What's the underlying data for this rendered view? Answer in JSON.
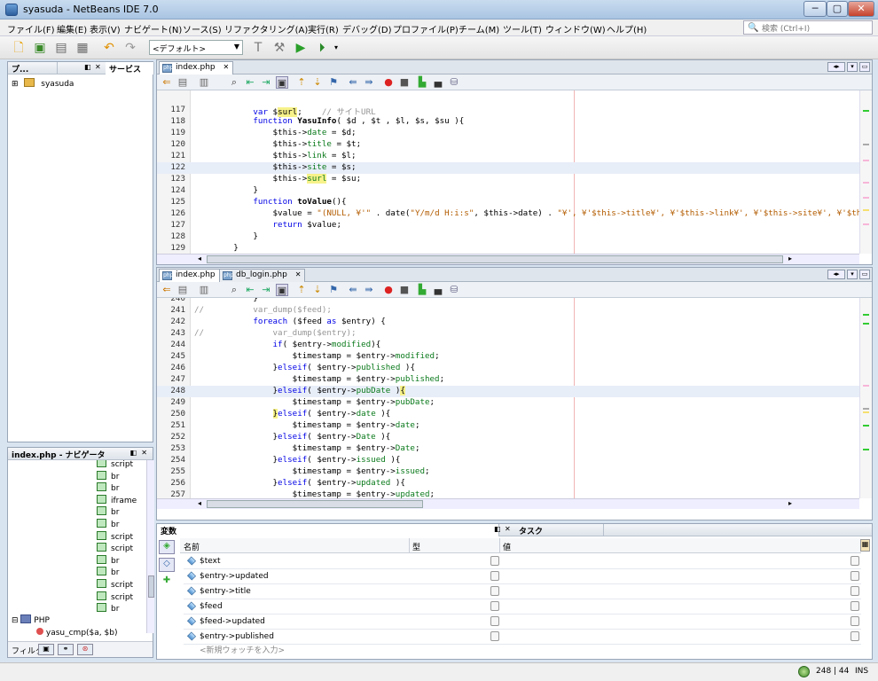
{
  "window": {
    "title": "syasuda - NetBeans IDE 7.0",
    "min_label": "─",
    "max_label": "▢",
    "close_label": "✕"
  },
  "menubar": {
    "items": [
      "ファイル(F)",
      "編集(E)",
      "表示(V)",
      "ナビゲート(N)",
      "ソース(S)",
      "リファクタリング(A)",
      "実行(R)",
      "デバッグ(D)",
      "プロファイル(P)",
      "チーム(M)",
      "ツール(T)",
      "ウィンドウ(W)",
      "ヘルプ(H)"
    ],
    "search_placeholder": "検索 (Ctrl+I)"
  },
  "toolbar": {
    "config": "<デフォルト>"
  },
  "projects_panel": {
    "tabs": [
      "プ...",
      "サービス"
    ],
    "tree": [
      {
        "label": "syasuda",
        "expand": "⊞"
      }
    ]
  },
  "navigator_panel": {
    "title": "index.php - ナビゲータ",
    "items": [
      "script",
      "br",
      "br",
      "iframe",
      "br",
      "br",
      "script",
      "script",
      "br",
      "br",
      "script",
      "script",
      "br"
    ],
    "php_label": "PHP",
    "function_label": "yasu_cmp($a, $b)",
    "filter_label": "フィルタ:"
  },
  "editor_top": {
    "tab": "index.php",
    "lines": [
      {
        "n": "117",
        "html": "            <span class=\"kw\">var</span> $<span class=\"yel\">surl</span>;    <span class=\"cm\">// サイトURL</span>"
      },
      {
        "n": "118",
        "html": "            <span class=\"kw\">function</span> <span class=\"fn\">YasuInfo</span>( $d , $t , $l, $s, $su ){"
      },
      {
        "n": "119",
        "html": "                $this-><span class=\"vr\">date</span> = $d;"
      },
      {
        "n": "120",
        "html": "                $this-><span class=\"vr\">title</span> = $t;"
      },
      {
        "n": "121",
        "html": "                $this-><span class=\"vr\">link</span> = $l;"
      },
      {
        "n": "122",
        "html": "                $this-><span class=\"vr\">site</span> = $s;"
      },
      {
        "n": "123",
        "html": "                $this-><span class=\"vr yel\">surl</span> = $su;"
      },
      {
        "n": "124",
        "html": "            }"
      },
      {
        "n": "125",
        "html": "            <span class=\"kw\">function</span> <span class=\"fn\">toValue</span>(){"
      },
      {
        "n": "126",
        "html": "                $value = <span class=\"str\">\"(NULL, ¥'\"</span> . date(<span class=\"str\">\"Y/m/d H:i:s\"</span>, $this->date) . <span class=\"str\">\"¥', ¥'$this->title¥', ¥'$this->link¥', ¥'$this->site¥', ¥'$this-</span>"
      },
      {
        "n": "127",
        "html": "                <span class=\"kw\">return</span> $value;"
      },
      {
        "n": "128",
        "html": "            }"
      },
      {
        "n": "129",
        "html": "        }"
      }
    ]
  },
  "editor_bottom": {
    "tabs": [
      "index.php",
      "db_login.php"
    ],
    "lines": [
      {
        "n": "240",
        "html": "            }"
      },
      {
        "n": "241",
        "html": "<span class=\"cm\">//          var_dump($feed);</span>"
      },
      {
        "n": "242",
        "html": "            <span class=\"kw\">foreach</span> ($feed <span class=\"kw\">as</span> $entry) {"
      },
      {
        "n": "243",
        "html": "<span class=\"cm\">//              var_dump($entry);</span>"
      },
      {
        "n": "244",
        "html": "                <span class=\"kw\">if</span>( $entry-><span class=\"vr\">modified</span>){"
      },
      {
        "n": "245",
        "html": "                    $timestamp = $entry-><span class=\"vr\">modified</span>;"
      },
      {
        "n": "246",
        "html": "                }<span class=\"kw\">elseif</span>( $entry-><span class=\"vr\">published</span> ){"
      },
      {
        "n": "247",
        "html": "                    $timestamp = $entry-><span class=\"vr\">published</span>;"
      },
      {
        "n": "248",
        "html": "                }<span class=\"kw\">elseif</span>( $entry-><span class=\"vr\">pubDate</span> )<span class=\"yel\">{</span>"
      },
      {
        "n": "249",
        "html": "                    $timestamp = $entry-><span class=\"vr\">pubDate</span>;"
      },
      {
        "n": "250",
        "html": "                <span class=\"yel\">}</span><span class=\"kw\">elseif</span>( $entry-><span class=\"vr\">date</span> ){"
      },
      {
        "n": "251",
        "html": "                    $timestamp = $entry-><span class=\"vr\">date</span>;"
      },
      {
        "n": "252",
        "html": "                }<span class=\"kw\">elseif</span>( $entry-><span class=\"vr\">Date</span> ){"
      },
      {
        "n": "253",
        "html": "                    $timestamp = $entry-><span class=\"vr\">Date</span>;"
      },
      {
        "n": "254",
        "html": "                }<span class=\"kw\">elseif</span>( $entry-><span class=\"vr\">issued</span> ){"
      },
      {
        "n": "255",
        "html": "                    $timestamp = $entry-><span class=\"vr\">issued</span>;"
      },
      {
        "n": "256",
        "html": "                }<span class=\"kw\">elseif</span>( $entry-><span class=\"vr\">updated</span> ){"
      },
      {
        "n": "257",
        "html": "                    $timestamp = $entry-><span class=\"vr\">updated</span>;"
      }
    ]
  },
  "variables_panel": {
    "tabs": [
      "変数",
      "タスク"
    ],
    "columns": [
      "名前",
      "型",
      "値"
    ],
    "rows": [
      "$text",
      "$entry->updated",
      "$entry->title",
      "$feed",
      "$feed->updated",
      "$entry->published"
    ],
    "new_watch": "<新規ウォッチを入力>"
  },
  "statusbar": {
    "position": "248 | 44",
    "mode": "INS"
  }
}
